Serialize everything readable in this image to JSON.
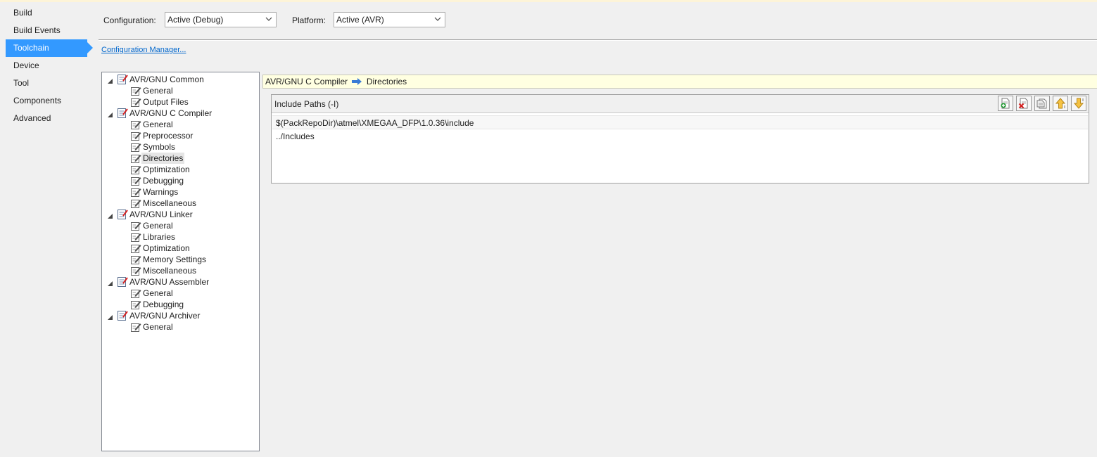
{
  "nav": {
    "items": [
      "Build",
      "Build Events",
      "Toolchain",
      "Device",
      "Tool",
      "Components",
      "Advanced"
    ],
    "active": "Toolchain"
  },
  "config": {
    "configuration_label": "Configuration:",
    "configuration_value": "Active (Debug)",
    "platform_label": "Platform:",
    "platform_value": "Active (AVR)",
    "manager_link": "Configuration Manager..."
  },
  "tree": {
    "groups": [
      {
        "label": "AVR/GNU Common",
        "children": [
          "General",
          "Output Files"
        ]
      },
      {
        "label": "AVR/GNU C Compiler",
        "children": [
          "General",
          "Preprocessor",
          "Symbols",
          "Directories",
          "Optimization",
          "Debugging",
          "Warnings",
          "Miscellaneous"
        ]
      },
      {
        "label": "AVR/GNU Linker",
        "children": [
          "General",
          "Libraries",
          "Optimization",
          "Memory Settings",
          "Miscellaneous"
        ]
      },
      {
        "label": "AVR/GNU Assembler",
        "children": [
          "General",
          "Debugging"
        ]
      },
      {
        "label": "AVR/GNU Archiver",
        "children": [
          "General"
        ]
      }
    ],
    "selected": "Directories"
  },
  "breadcrumb": {
    "section": "AVR/GNU C Compiler",
    "page": "Directories"
  },
  "include_paths": {
    "title": "Include Paths (-I)",
    "items": [
      "$(PackRepoDir)\\atmel\\XMEGAA_DFP\\1.0.36\\include",
      "../Includes"
    ],
    "toolbar_icons": [
      "add-item-icon",
      "delete-item-icon",
      "edit-item-icon",
      "move-up-icon",
      "move-down-icon"
    ]
  },
  "colors": {
    "accent": "#3399ff",
    "link": "#0066cc",
    "breadcrumb_bg": "#ffffe1"
  }
}
